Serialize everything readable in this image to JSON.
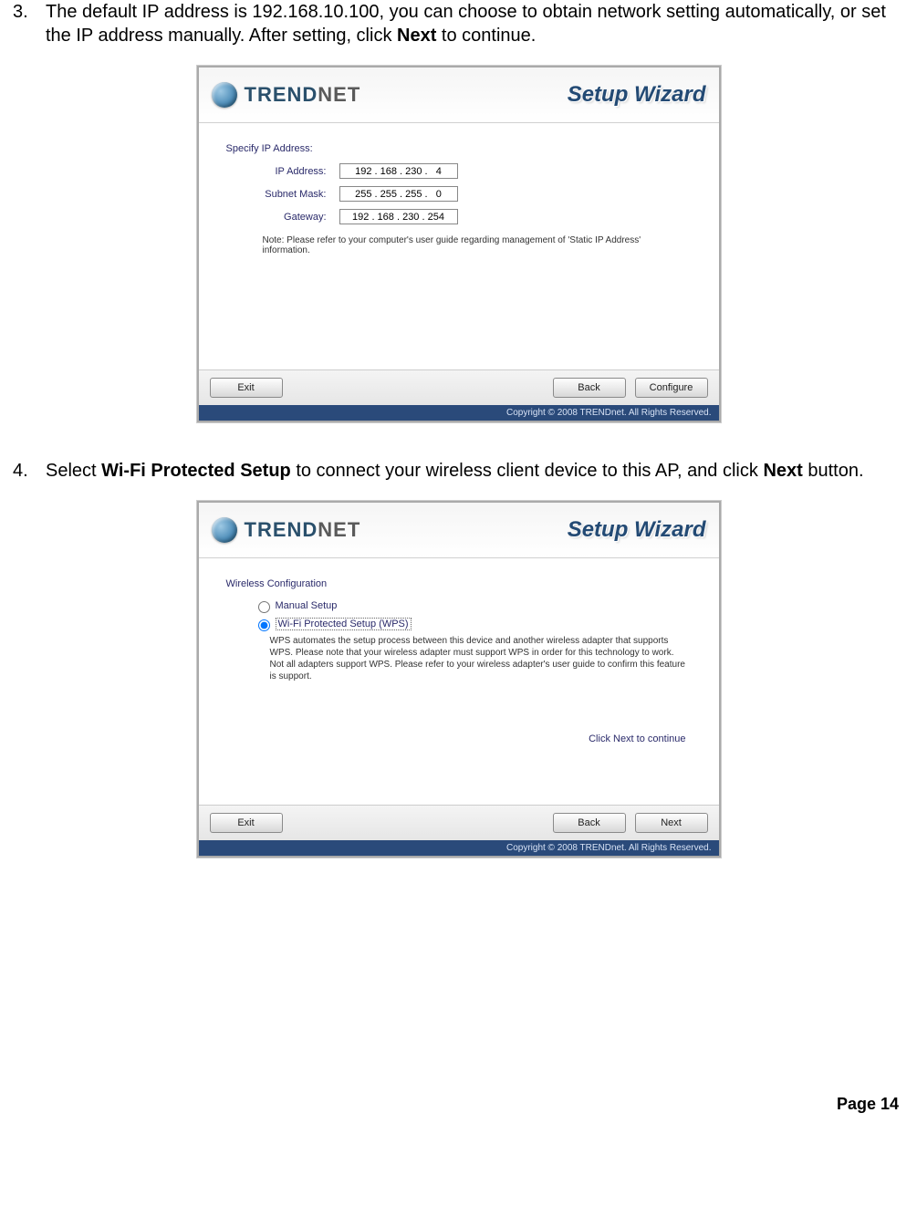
{
  "step3": {
    "num": "3.",
    "text_a": "The default IP address is 192.168.10.100, you can choose to obtain network setting automatically, or set the IP address manually. After setting, click ",
    "bold": "Next",
    "text_b": " to continue."
  },
  "step4": {
    "num": "4.",
    "text_a": "Select ",
    "bold1": "Wi-Fi Protected Setup",
    "text_mid": " to connect your wireless client device to this AP, and click ",
    "bold2": "Next",
    "text_b": " button."
  },
  "brand": {
    "trend": "TREND",
    "net": "NET",
    "wizard": "Setup Wizard"
  },
  "wiz1": {
    "section": "Specify IP Address:",
    "ip_label": "IP Address:",
    "mask_label": "Subnet Mask:",
    "gw_label": "Gateway:",
    "ip": "192 . 168 . 230 .   4",
    "mask": "255 . 255 . 255 .   0",
    "gw": "192 . 168 . 230 . 254",
    "note": "Note: Please refer to your computer's user guide regarding management of 'Static IP Address' information.",
    "exit": "Exit",
    "back": "Back",
    "configure": "Configure"
  },
  "wiz2": {
    "section": "Wireless Configuration",
    "manual": "Manual Setup",
    "wps": "Wi-Fi Protected Setup (WPS)",
    "note": "WPS automates the setup process between this device and another wireless adapter that supports WPS. Please note that your wireless adapter must support WPS in order for this technology to work. Not all adapters support WPS. Please refer to your wireless adapter's user guide to confirm this feature is support.",
    "continue": "Click Next to continue",
    "exit": "Exit",
    "back": "Back",
    "next": "Next"
  },
  "footer": "Copyright © 2008 TRENDnet. All Rights Reserved.",
  "page_num": "Page  14"
}
